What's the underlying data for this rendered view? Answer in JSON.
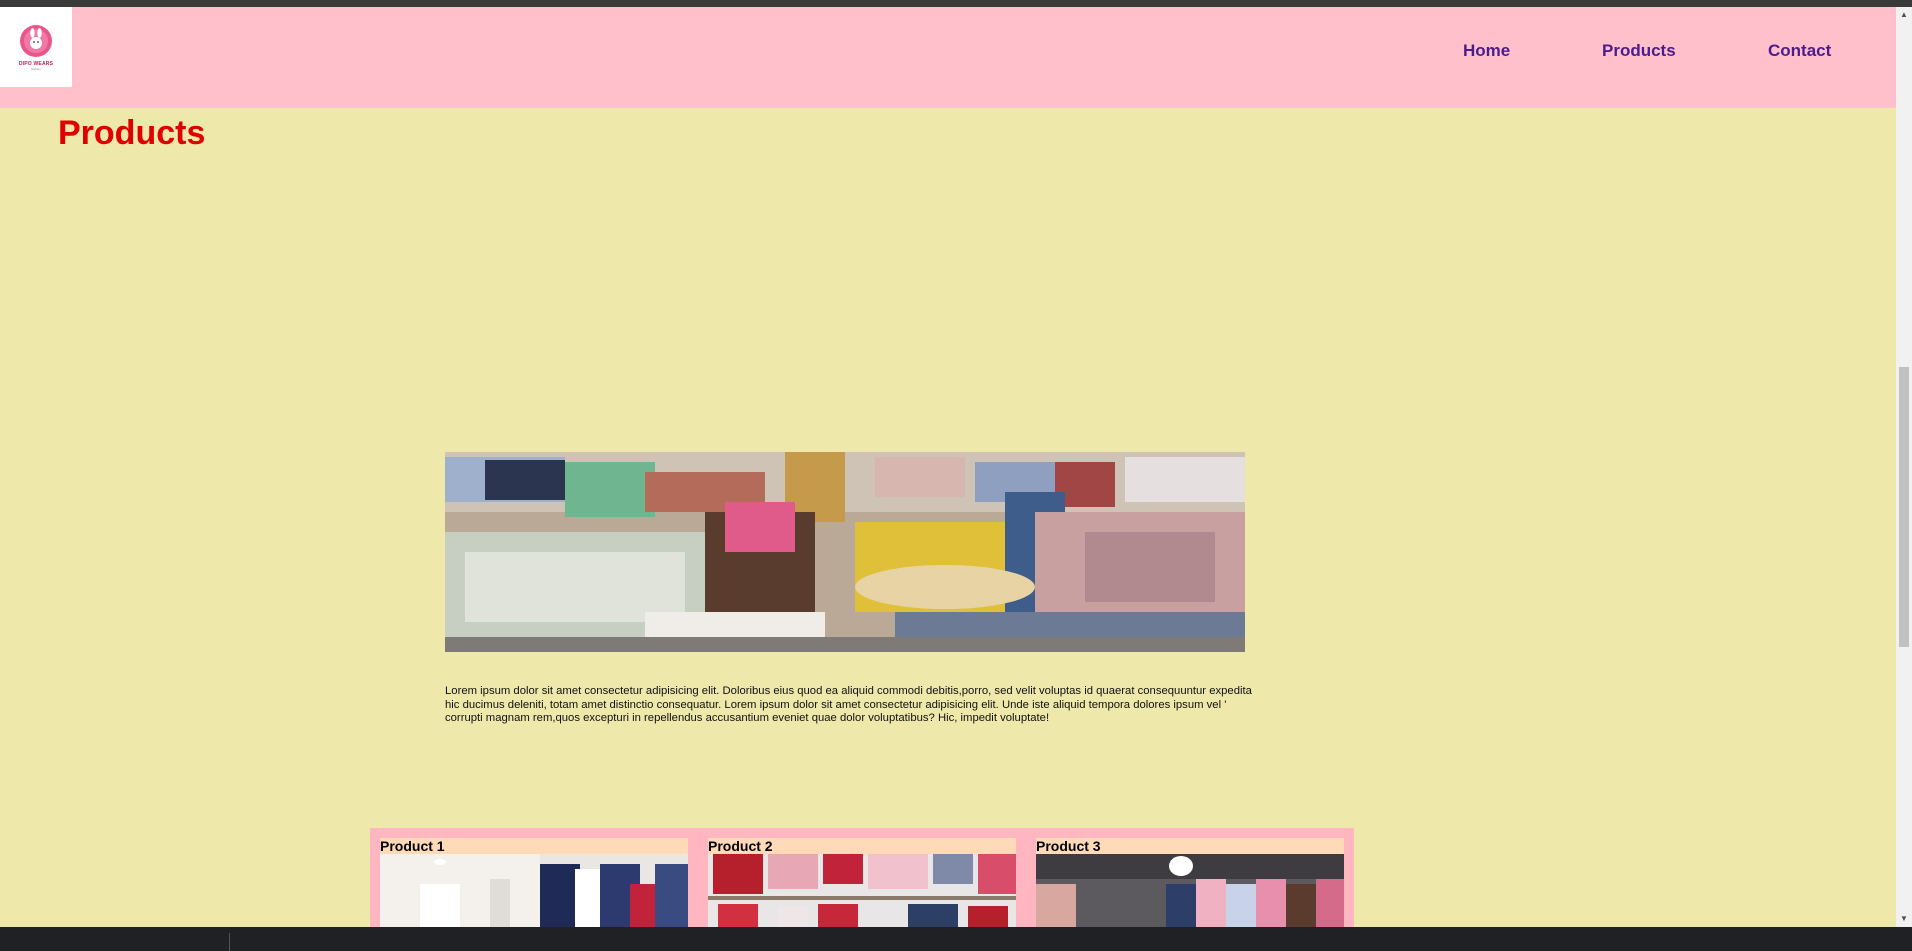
{
  "brand": {
    "name": "DIPO WEARS",
    "tagline": "fashion"
  },
  "nav": {
    "home": "Home",
    "products": "Products",
    "contact": "Contact"
  },
  "page": {
    "title": "Products"
  },
  "intro": {
    "text": "Lorem ipsum dolor sit amet consectetur adipisicing elit. Doloribus eius quod ea aliquid commodi debitis,porro, sed velit voluptas id quaerat consequuntur expedita hic ducimus deleniti, totam amet distinctio consequatur. Lorem ipsum dolor sit amet consectetur adipisicing elit. Unde iste aliquid tempora dolores ipsum vel ' corrupti magnam rem,quos excepturi in repellendus accusantium eveniet quae dolor voluptatibus? Hic, impedit voluptate!"
  },
  "products": [
    {
      "title": "Product 1"
    },
    {
      "title": "Product 2"
    },
    {
      "title": "Product 3"
    }
  ],
  "colors": {
    "page_bg": "#eee8aa",
    "header_bg": "#ffc0cb",
    "nav_text": "#4b1c8c",
    "title": "#e00000",
    "strip_bg": "#ffb6c1",
    "card_bg": "#ffdab9"
  }
}
